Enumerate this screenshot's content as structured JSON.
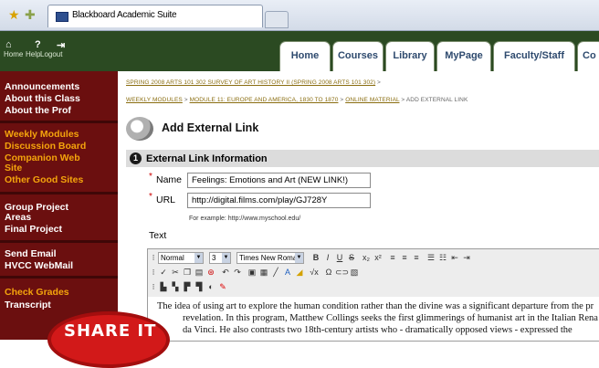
{
  "browser": {
    "tab_title": "Blackboard Academic Suite"
  },
  "header": {
    "utility_links": [
      "Home",
      "Help",
      "Logout"
    ],
    "tabs": [
      "Home",
      "Courses",
      "Library",
      "MyPage",
      "Faculty/Staff",
      "Co"
    ]
  },
  "menu": {
    "group1": [
      "Announcements",
      "About this Class",
      "About the Prof"
    ],
    "group2": [
      "Weekly Modules",
      "Discussion Board",
      "Companion Web",
      "Site",
      "Other Good Sites"
    ],
    "group3": [
      "Group Project",
      "Areas",
      "Final Project"
    ],
    "group4": [
      "Send Email",
      "HVCC WebMail"
    ],
    "group5": [
      "Check Grades",
      "Transcript"
    ]
  },
  "stamp": {
    "text": "SHARE IT"
  },
  "breadcrumb": {
    "line1": "SPRING 2008 ARTS 101 302 SURVEY OF ART HISTORY II (SPRING 2008 ARTS 101 302)",
    "line2": [
      {
        "text": "WEEKLY MODULES",
        "link": true
      },
      {
        "text": "MODULE 11: EUROPE AND AMERICA, 1830 TO 1870",
        "link": true
      },
      {
        "text": "ONLINE MATERIAL",
        "link": true
      },
      {
        "text": "ADD EXTERNAL LINK",
        "link": false
      }
    ]
  },
  "page": {
    "title": "Add External Link",
    "section_number": "1",
    "section_title": "External Link Information"
  },
  "form": {
    "name_label": "Name",
    "name_value": "Feelings: Emotions and Art (NEW LINK!)",
    "url_label": "URL",
    "url_value": "http://digital.films.com/play/GJ728Y",
    "url_example": "For example: http://www.myschool.edu/",
    "text_label": "Text"
  },
  "editor": {
    "style_select": "Normal",
    "size_select": "3",
    "font_select": "Times New Roman",
    "body_lines": [
      "The idea of using art to explore the human condition rather than the divine was a significant departure from the pr",
      "revelation. In this program, Matthew Collings seeks the first glimmerings of humanist art in the Italian Rena",
      "da Vinci. He also contrasts two 18th-century artists who - dramatically opposed views - expressed the"
    ]
  },
  "colors": {
    "header_green": "#2b4a22",
    "menu_maroon": "#6b0f0f",
    "menu_gold": "#f4a40c",
    "stamp_red": "#d21919"
  }
}
